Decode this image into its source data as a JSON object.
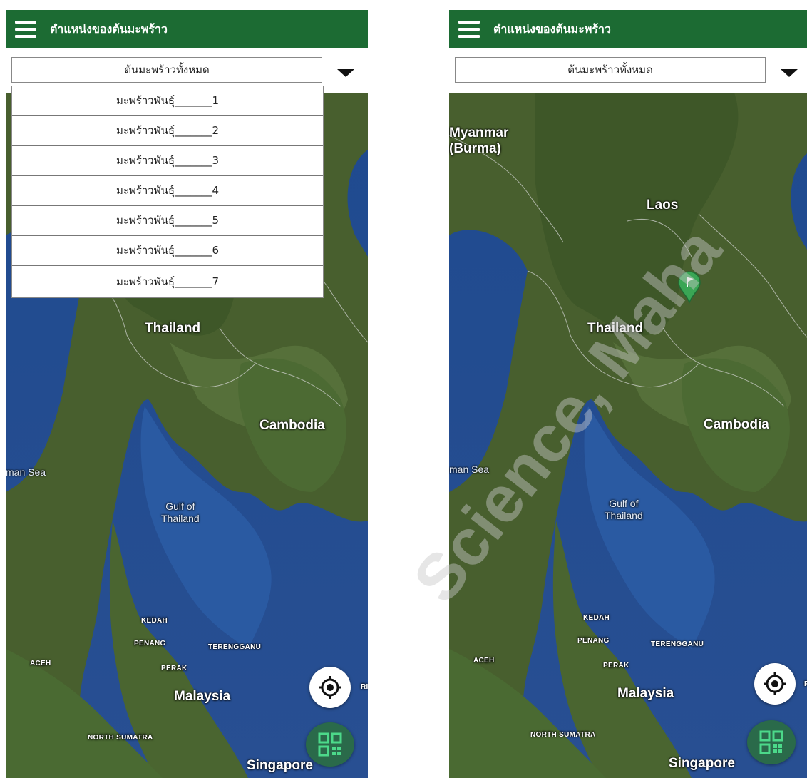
{
  "app": {
    "title": "ตำแหน่งของต้นมะพร้าว"
  },
  "filter": {
    "selected": "ต้นมะพร้าวทั้งหมด",
    "options": [
      "มะพร้าวพันธุ์_______1",
      "มะพร้าวพันธุ์_______2",
      "มะพร้าวพันธุ์_______3",
      "มะพร้าวพันธุ์_______4",
      "มะพร้าวพันธุ์_______5",
      "มะพร้าวพันธุ์_______6",
      "มะพร้าวพันธุ์_______7"
    ]
  },
  "map": {
    "labels": {
      "myanmar": "Myanmar",
      "burma": "(Burma)",
      "laos": "Laos",
      "thailand": "Thailand",
      "cambodia": "Cambodia",
      "andaman_sea": "man Sea",
      "gulf_line1": "Gulf of",
      "gulf_line2": "Thailand",
      "kedah": "KEDAH",
      "penang": "PENANG",
      "terengganu": "TERENGGANU",
      "aceh": "ACEH",
      "perak": "PERAK",
      "malaysia": "Malaysia",
      "north_sumatra": "NORTH SUMATRA",
      "singapore": "Singapore",
      "edge_right": "RI"
    }
  },
  "watermark": {
    "text": "Science, Maha"
  },
  "colors": {
    "appbar": "#1c6b33",
    "marker": "#3aa655",
    "qr_button": "#2a6a4a",
    "qr_icon": "#4cd98a",
    "sea": "#234a8c",
    "land": "#4a6530"
  },
  "icons": {
    "menu": "hamburger-icon",
    "dropdown": "caret-down-icon",
    "locate": "crosshair-icon",
    "qr": "qr-code-icon",
    "marker": "map-pin-flag-icon"
  }
}
